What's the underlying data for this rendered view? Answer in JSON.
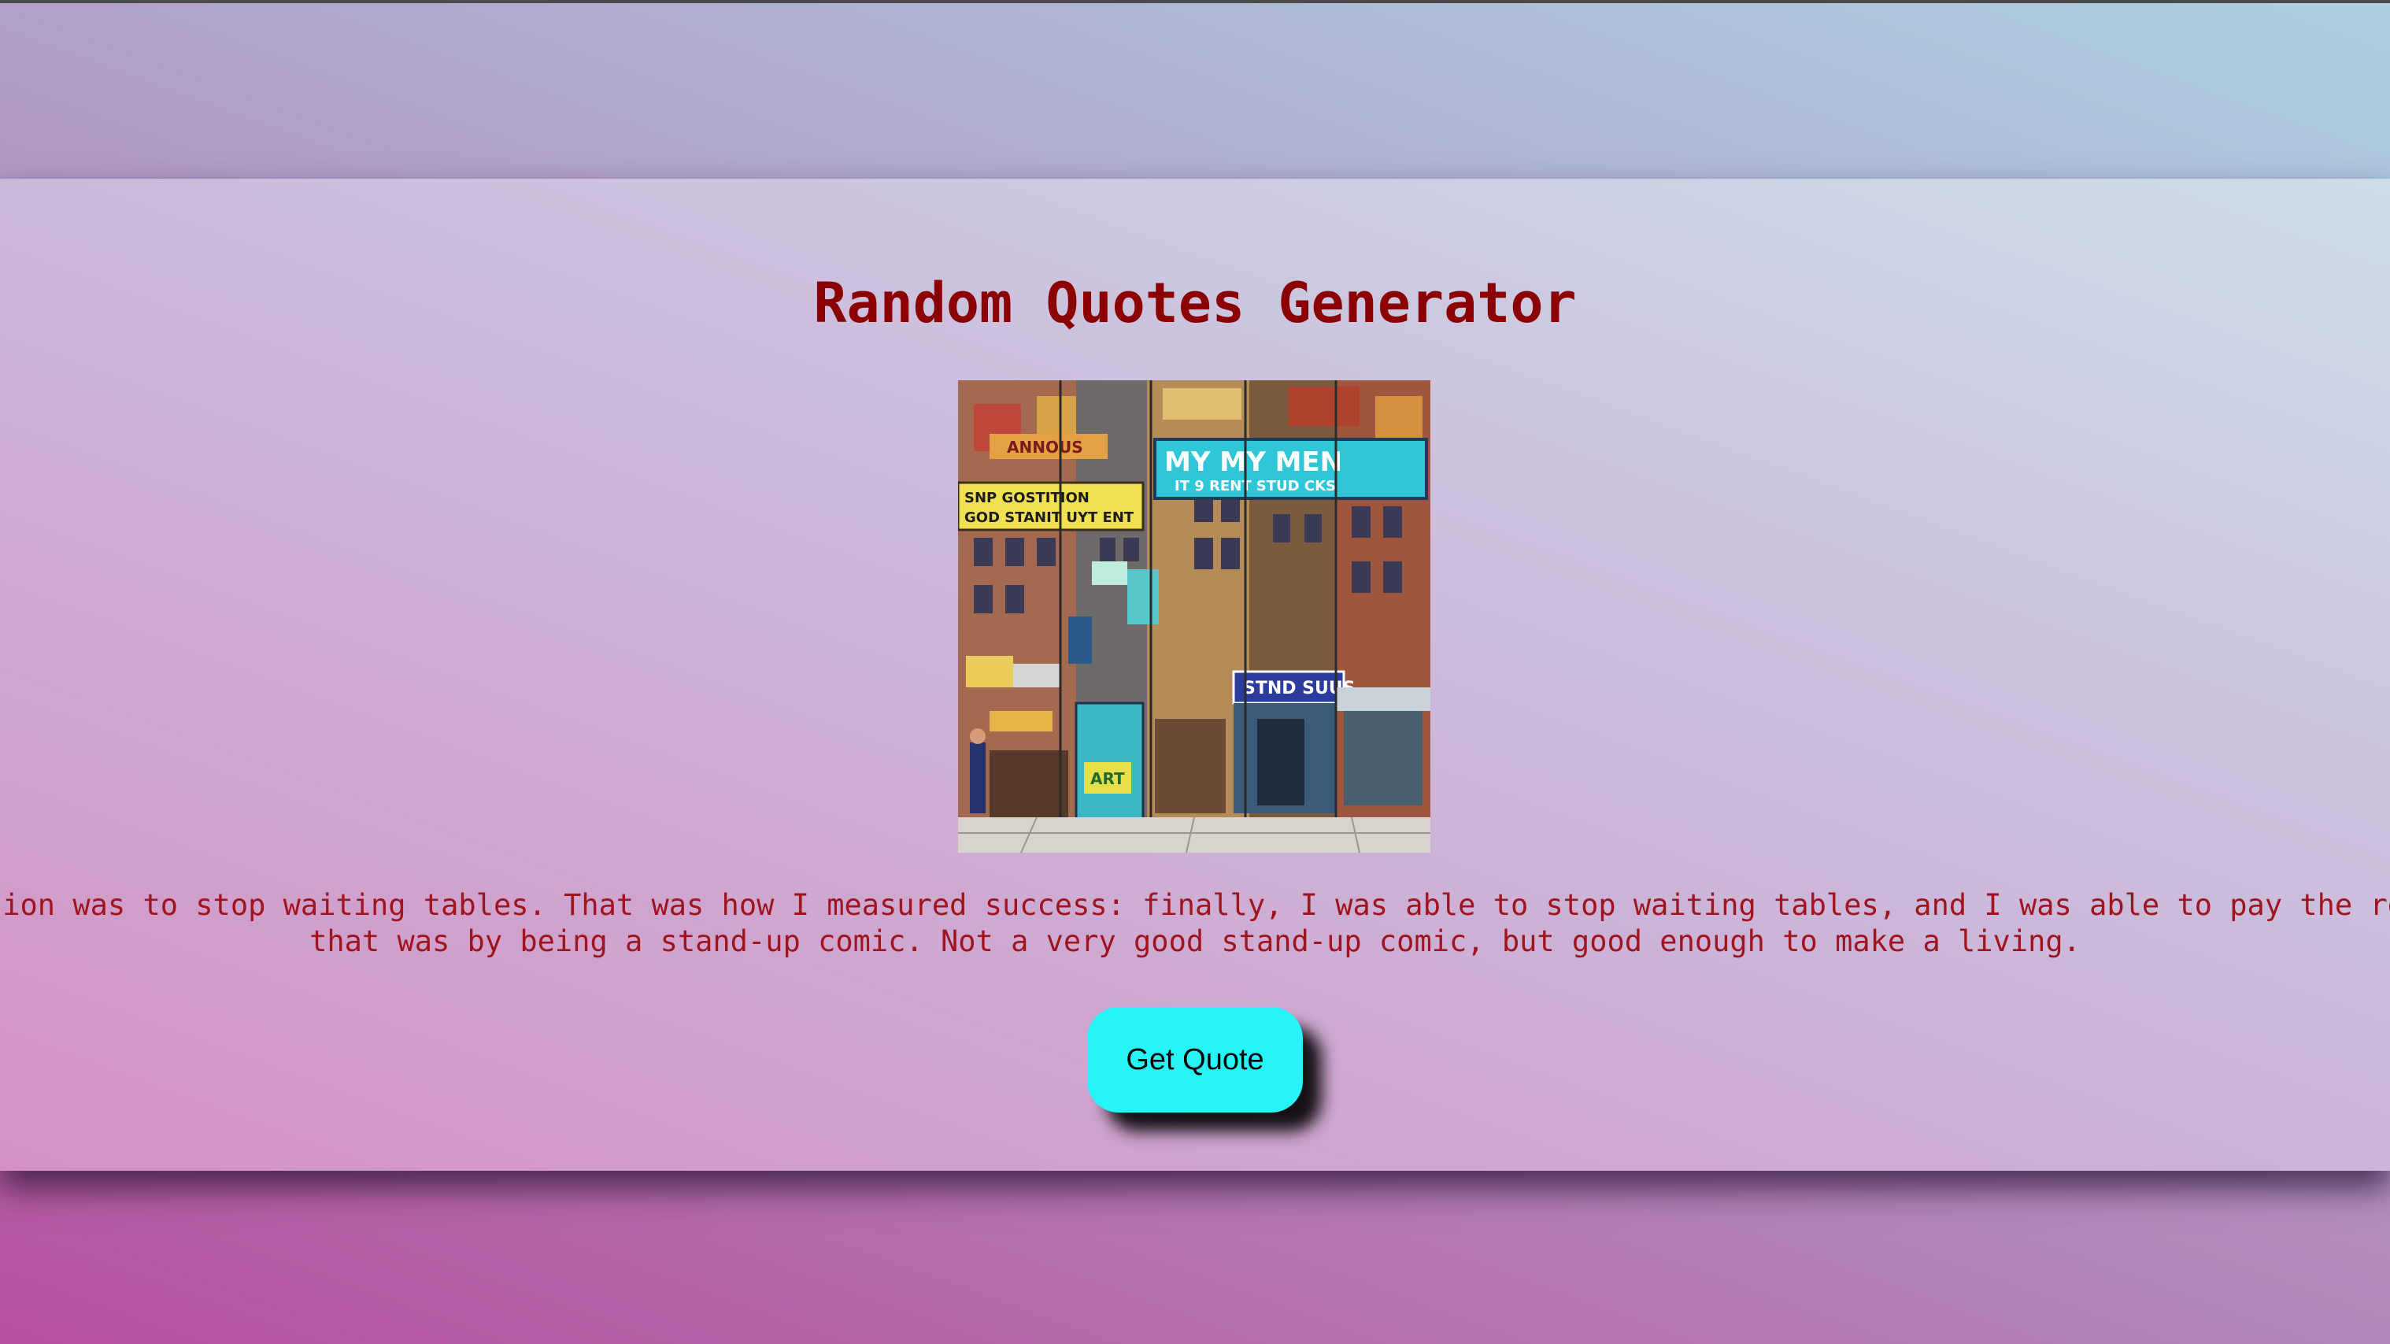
{
  "page": {
    "title": "Random Quotes Generator"
  },
  "image": {
    "alt": "",
    "signs": {
      "sign_1": "MY MY MEN",
      "sign_2": "IT 9 RENT STUD CKS",
      "sign_3": "SNP GOSTITION",
      "sign_4": "GOD STANIT UYT ENT",
      "sign_5": "STND SUUS",
      "sign_6": "ART",
      "sign_7": "ANNOUS"
    }
  },
  "quote": {
    "line_1": "My ambition was to stop waiting tables. That was how I measured success: finally, I was able to stop waiting tables, and I was able to pay the rent, and",
    "line_2": "that was by being a stand-up comic. Not a very good stand-up comic, but good enough to make a living."
  },
  "button": {
    "label": "Get Quote"
  },
  "colors": {
    "title": "#8b0000",
    "quote_text": "#a0141e",
    "button_bg": "#27f4f8",
    "button_text": "#000000"
  }
}
